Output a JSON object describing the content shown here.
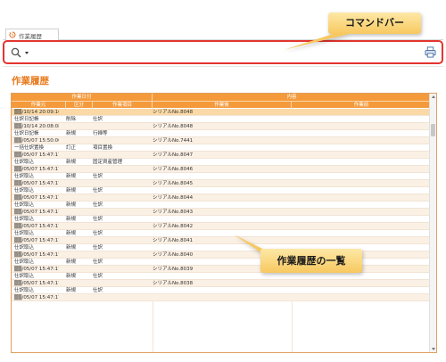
{
  "tab": {
    "label": "作業履歴"
  },
  "callouts": {
    "command_bar": "コマンドバー",
    "history_list": "作業履歴の一覧"
  },
  "page": {
    "title": "作業履歴"
  },
  "table": {
    "group_headers": [
      "作業日付",
      "内容"
    ],
    "columns": [
      "作業元",
      "区分",
      "作業項目",
      "作業後",
      "作業前"
    ],
    "rows": [
      {
        "kind": "sel",
        "c1": "▒▒/10/14 20:09:16",
        "c2": "",
        "c3": "",
        "c4": "シリアルNo.8048"
      },
      {
        "kind": "main",
        "c1": "仕訳日記帳",
        "c2": "削除",
        "c3": "仕訳",
        "c4": ""
      },
      {
        "kind": "sub",
        "c1": "▒▒/10/14 20:08:08",
        "c2": "",
        "c3": "",
        "c4": "シリアルNo.8048"
      },
      {
        "kind": "main",
        "c1": "仕訳日記帳",
        "c2": "新規",
        "c3": "行挿等",
        "c4": ""
      },
      {
        "kind": "sub",
        "c1": "▒▒/05/07 15:50:06",
        "c2": "",
        "c3": "",
        "c4": "シリアルNo.7441"
      },
      {
        "kind": "main",
        "c1": "一括仕訳置換",
        "c2": "訂正",
        "c3": "項目置換",
        "c4": ""
      },
      {
        "kind": "sub",
        "c1": "▒▒/05/07 15:47:17",
        "c2": "",
        "c3": "",
        "c4": "シリアルNo.8047"
      },
      {
        "kind": "main",
        "c1": "仕訳取込",
        "c2": "新規",
        "c3": "固定資産管理",
        "c4": ""
      },
      {
        "kind": "sub",
        "c1": "▒▒/05/07 15:47:17",
        "c2": "",
        "c3": "",
        "c4": "シリアルNo.8046"
      },
      {
        "kind": "main",
        "c1": "仕訳取込",
        "c2": "新規",
        "c3": "仕訳",
        "c4": ""
      },
      {
        "kind": "sub",
        "c1": "▒▒/05/07 15:47:17",
        "c2": "",
        "c3": "",
        "c4": "シリアルNo.8045"
      },
      {
        "kind": "main",
        "c1": "仕訳取込",
        "c2": "新規",
        "c3": "仕訳",
        "c4": ""
      },
      {
        "kind": "sub",
        "c1": "▒▒/05/07 15:47:17",
        "c2": "",
        "c3": "",
        "c4": "シリアルNo.8044"
      },
      {
        "kind": "main",
        "c1": "仕訳取込",
        "c2": "新規",
        "c3": "仕訳",
        "c4": ""
      },
      {
        "kind": "sub",
        "c1": "▒▒/05/07 15:47:17",
        "c2": "",
        "c3": "",
        "c4": "シリアルNo.8043"
      },
      {
        "kind": "main",
        "c1": "仕訳取込",
        "c2": "新規",
        "c3": "仕訳",
        "c4": ""
      },
      {
        "kind": "sub",
        "c1": "▒▒/05/07 15:47:17",
        "c2": "",
        "c3": "",
        "c4": "シリアルNo.8042"
      },
      {
        "kind": "main",
        "c1": "仕訳取込",
        "c2": "新規",
        "c3": "仕訳",
        "c4": ""
      },
      {
        "kind": "sub",
        "c1": "▒▒/05/07 15:47:17",
        "c2": "",
        "c3": "",
        "c4": "シリアルNo.8041"
      },
      {
        "kind": "main",
        "c1": "仕訳取込",
        "c2": "新規",
        "c3": "仕訳",
        "c4": ""
      },
      {
        "kind": "sub",
        "c1": "▒▒/05/07 15:47:17",
        "c2": "",
        "c3": "",
        "c4": "シリアルNo.8040"
      },
      {
        "kind": "main",
        "c1": "仕訳取込",
        "c2": "新規",
        "c3": "仕訳",
        "c4": ""
      },
      {
        "kind": "sub",
        "c1": "▒▒/05/07 15:47:17",
        "c2": "",
        "c3": "",
        "c4": "シリアルNo.8039"
      },
      {
        "kind": "main",
        "c1": "仕訳取込",
        "c2": "新規",
        "c3": "仕訳",
        "c4": ""
      },
      {
        "kind": "sub",
        "c1": "▒▒/05/07 15:47:17",
        "c2": "",
        "c3": "",
        "c4": "シリアルNo.8038"
      },
      {
        "kind": "main",
        "c1": "仕訳取込",
        "c2": "新規",
        "c3": "仕訳",
        "c4": ""
      },
      {
        "kind": "sub",
        "c1": "▒▒/05/07 15:47:17",
        "c2": "",
        "c3": "",
        "c4": ""
      }
    ]
  },
  "colors": {
    "accent": "#f49a3b",
    "title": "#e87a1c",
    "highlight_border": "#e3342f",
    "callout": "#f7c860"
  }
}
